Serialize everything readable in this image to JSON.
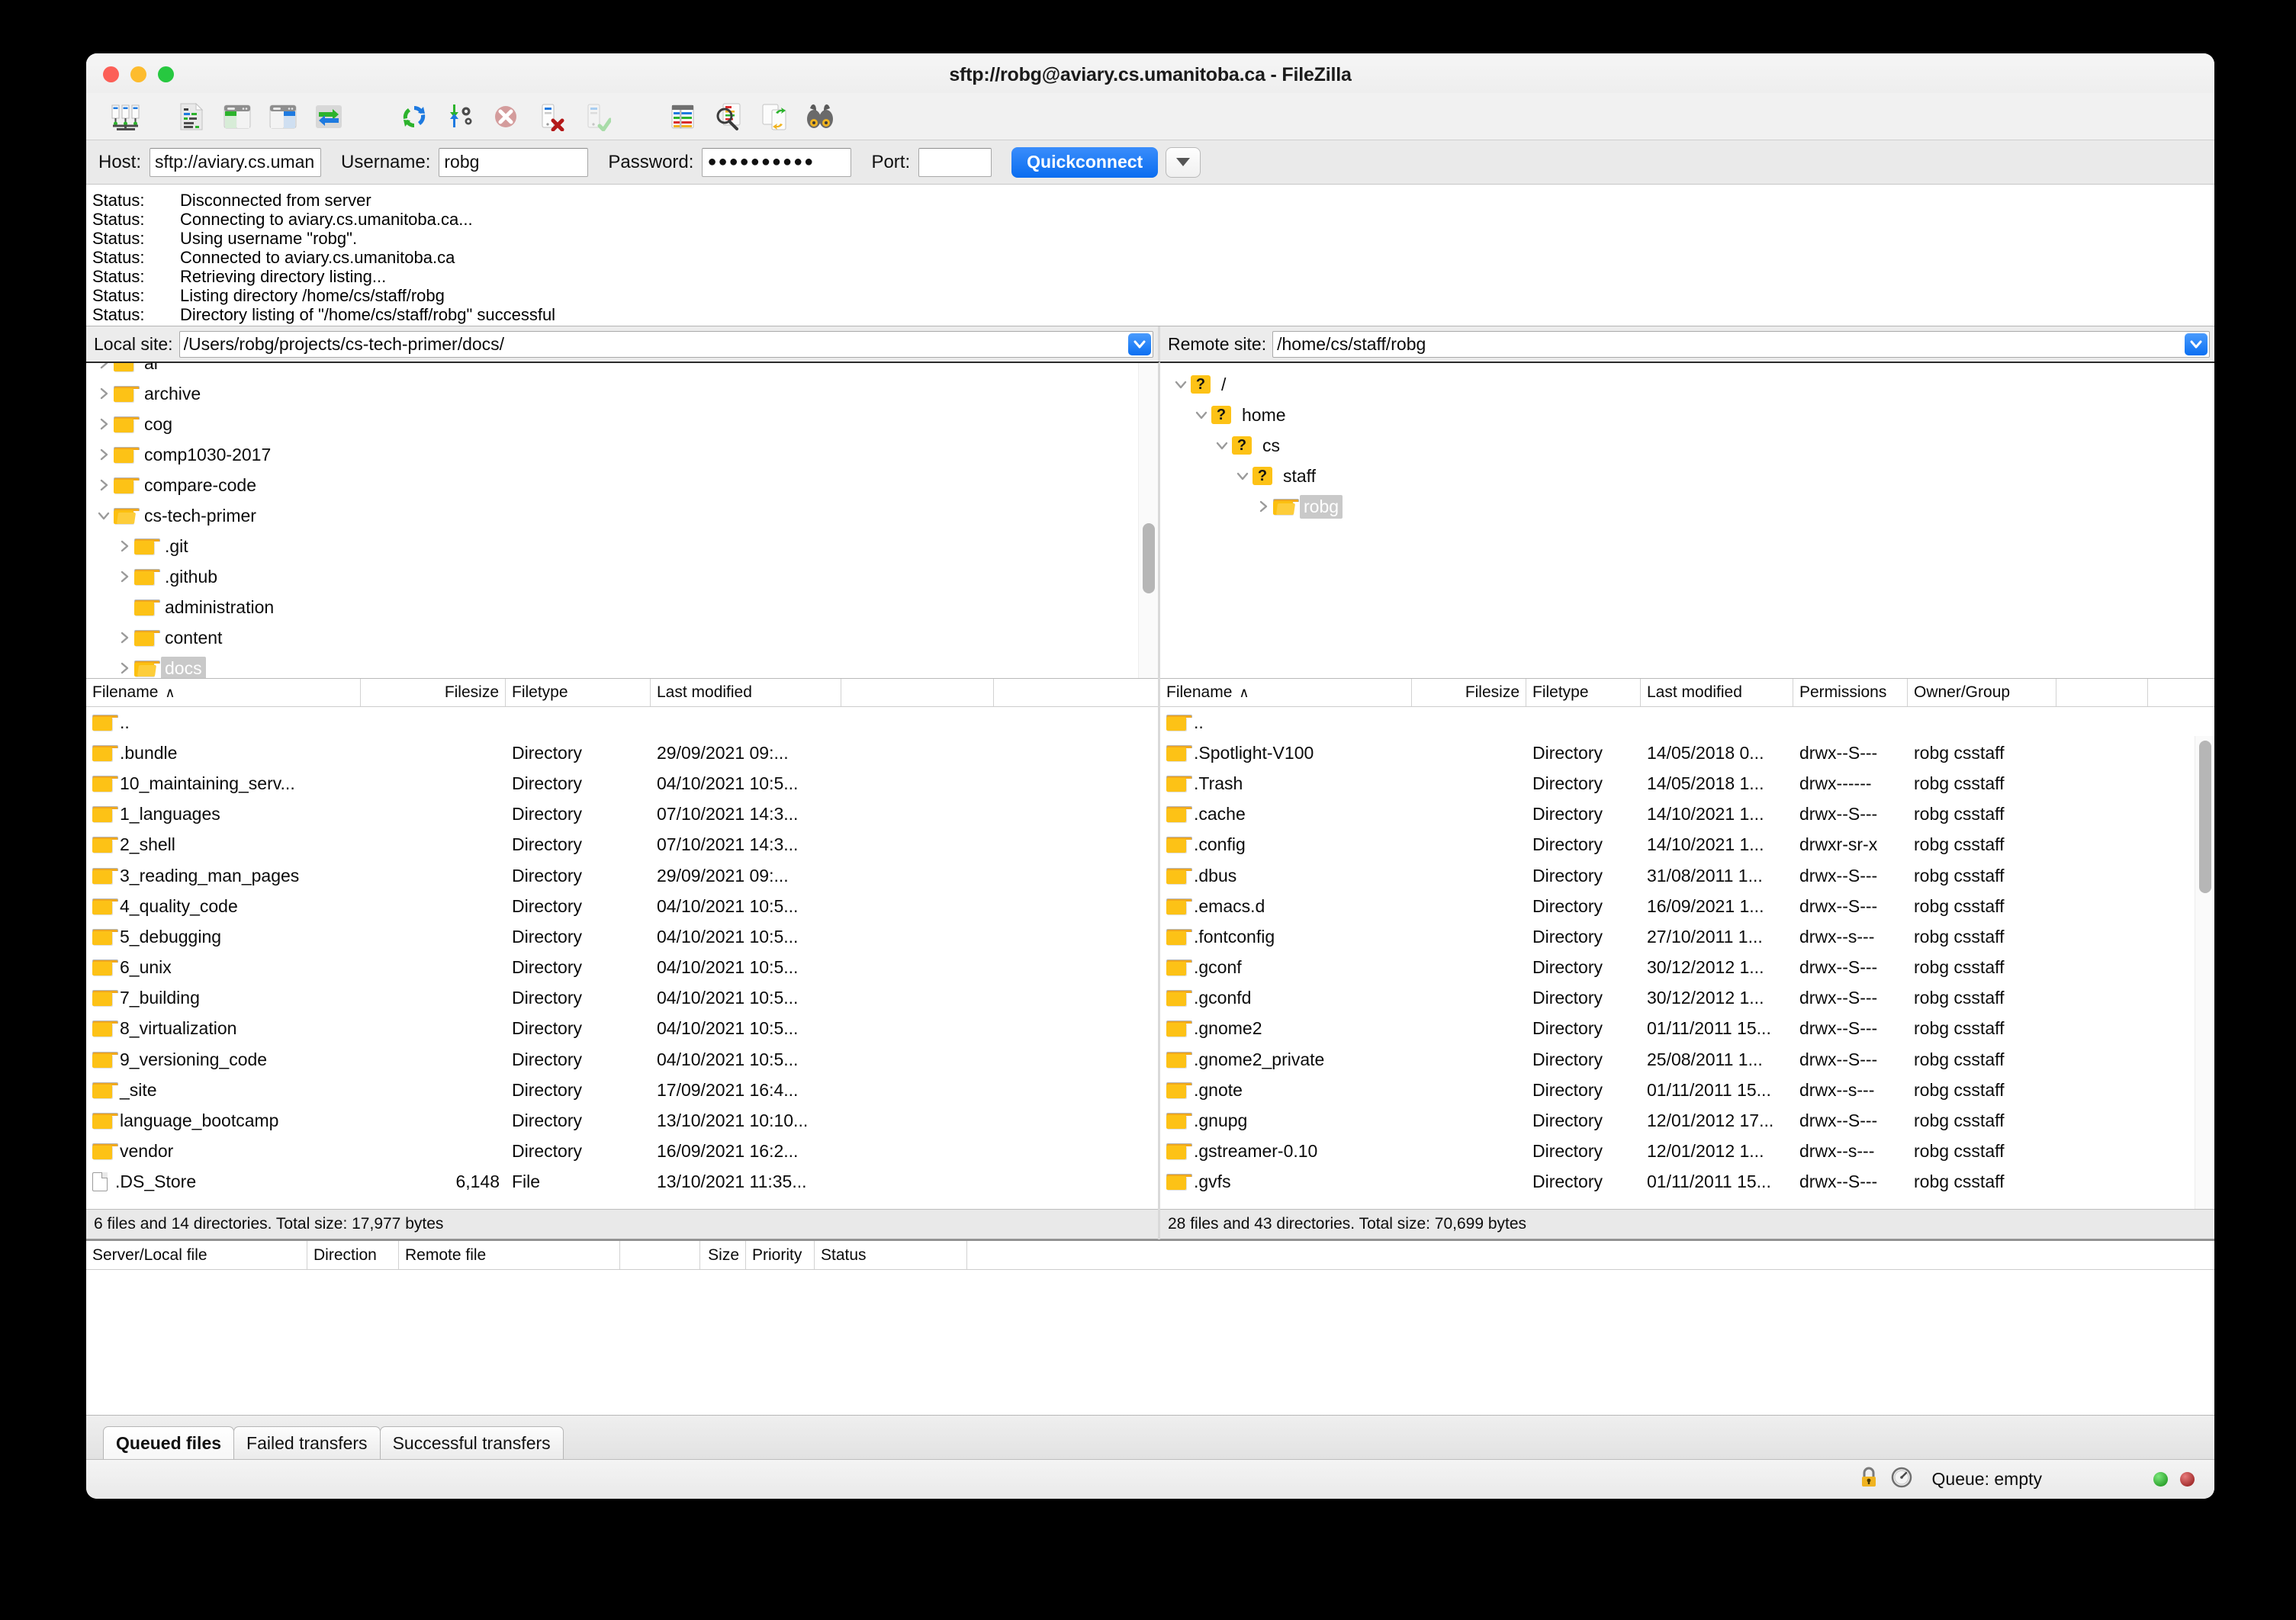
{
  "window": {
    "title": "sftp://robg@aviary.cs.umanitoba.ca - FileZilla",
    "traffic": {
      "close": "close-button",
      "minimize": "minimize-button",
      "zoom": "zoom-button"
    }
  },
  "toolbar": {
    "items": [
      {
        "name": "site-manager-icon",
        "title": "Open the Site Manager"
      },
      {
        "name": "toggle-message-log-icon",
        "title": "Toggles the display of the message log"
      },
      {
        "name": "toggle-local-tree-icon",
        "title": "Toggles the display of the local directory tree"
      },
      {
        "name": "toggle-remote-tree-icon",
        "title": "Toggles the display of the remote directory tree"
      },
      {
        "name": "toggle-transfer-queue-icon",
        "title": "Toggles the display of the transfer queue"
      },
      {
        "name": "refresh-icon",
        "title": "Refresh the file and folder lists"
      },
      {
        "name": "process-queue-icon",
        "title": "Process queue"
      },
      {
        "name": "cancel-icon",
        "title": "Cancel current operation"
      },
      {
        "name": "disconnect-icon",
        "title": "Disconnects from the currently visible server"
      },
      {
        "name": "reconnect-icon",
        "title": "Reconnects to the last used server"
      },
      {
        "name": "filter-icon",
        "title": "Open the filename filter dialog"
      },
      {
        "name": "directory-comparison-icon",
        "title": "Toggle directory comparison"
      },
      {
        "name": "synchronized-browsing-icon",
        "title": "Toggle synchronized browsing"
      },
      {
        "name": "find-files-icon",
        "title": "Search for files recursively"
      }
    ]
  },
  "quickconnect": {
    "host_label": "Host:",
    "host_value": "sftp://aviary.cs.uman",
    "username_label": "Username:",
    "username_value": "robg",
    "password_label": "Password:",
    "password_value": "●●●●●●●●●●",
    "port_label": "Port:",
    "port_value": "",
    "connect_label": "Quickconnect",
    "dropdown_name": "quickconnect-history-dropdown"
  },
  "status_log": {
    "key": "Status:",
    "lines": [
      "Disconnected from server",
      "Connecting to aviary.cs.umanitoba.ca...",
      "Using username \"robg\".",
      "Connected to aviary.cs.umanitoba.ca",
      "Retrieving directory listing...",
      "Listing directory /home/cs/staff/robg",
      "Directory listing of \"/home/cs/staff/robg\" successful"
    ]
  },
  "local": {
    "site_label": "Local site:",
    "site_path": "/Users/robg/projects/cs-tech-primer/docs/",
    "tree": [
      {
        "label": "ai",
        "depth": 1,
        "twisty": "collapsed",
        "selected": false,
        "clipped": true
      },
      {
        "label": "archive",
        "depth": 1,
        "twisty": "collapsed",
        "selected": false
      },
      {
        "label": "cog",
        "depth": 1,
        "twisty": "collapsed",
        "selected": false
      },
      {
        "label": "comp1030-2017",
        "depth": 1,
        "twisty": "collapsed",
        "selected": false
      },
      {
        "label": "compare-code",
        "depth": 1,
        "twisty": "collapsed",
        "selected": false
      },
      {
        "label": "cs-tech-primer",
        "depth": 1,
        "twisty": "expanded",
        "selected": false
      },
      {
        "label": ".git",
        "depth": 2,
        "twisty": "collapsed",
        "selected": false
      },
      {
        "label": ".github",
        "depth": 2,
        "twisty": "collapsed",
        "selected": false
      },
      {
        "label": "administration",
        "depth": 2,
        "twisty": "none",
        "selected": false
      },
      {
        "label": "content",
        "depth": 2,
        "twisty": "collapsed",
        "selected": false
      },
      {
        "label": "docs",
        "depth": 2,
        "twisty": "collapsed",
        "selected": true
      },
      {
        "label": "",
        "depth": 2,
        "twisty": "collapsed",
        "selected": false,
        "clipped": true
      }
    ],
    "columns": [
      "Filename",
      "Filesize",
      "Filetype",
      "Last modified"
    ],
    "sort_column": "Filename",
    "sort_direction": "ascending",
    "rows": [
      {
        "name": "..",
        "size": "",
        "type": "",
        "modified": "",
        "icon": "folder"
      },
      {
        "name": ".bundle",
        "size": "",
        "type": "Directory",
        "modified": "29/09/2021 09:...",
        "icon": "folder"
      },
      {
        "name": "10_maintaining_serv...",
        "size": "",
        "type": "Directory",
        "modified": "04/10/2021 10:5...",
        "icon": "folder"
      },
      {
        "name": "1_languages",
        "size": "",
        "type": "Directory",
        "modified": "07/10/2021 14:3...",
        "icon": "folder"
      },
      {
        "name": "2_shell",
        "size": "",
        "type": "Directory",
        "modified": "07/10/2021 14:3...",
        "icon": "folder"
      },
      {
        "name": "3_reading_man_pages",
        "size": "",
        "type": "Directory",
        "modified": "29/09/2021 09:...",
        "icon": "folder"
      },
      {
        "name": "4_quality_code",
        "size": "",
        "type": "Directory",
        "modified": "04/10/2021 10:5...",
        "icon": "folder"
      },
      {
        "name": "5_debugging",
        "size": "",
        "type": "Directory",
        "modified": "04/10/2021 10:5...",
        "icon": "folder"
      },
      {
        "name": "6_unix",
        "size": "",
        "type": "Directory",
        "modified": "04/10/2021 10:5...",
        "icon": "folder"
      },
      {
        "name": "7_building",
        "size": "",
        "type": "Directory",
        "modified": "04/10/2021 10:5...",
        "icon": "folder"
      },
      {
        "name": "8_virtualization",
        "size": "",
        "type": "Directory",
        "modified": "04/10/2021 10:5...",
        "icon": "folder"
      },
      {
        "name": "9_versioning_code",
        "size": "",
        "type": "Directory",
        "modified": "04/10/2021 10:5...",
        "icon": "folder"
      },
      {
        "name": "_site",
        "size": "",
        "type": "Directory",
        "modified": "17/09/2021 16:4...",
        "icon": "folder"
      },
      {
        "name": "language_bootcamp",
        "size": "",
        "type": "Directory",
        "modified": "13/10/2021 10:10...",
        "icon": "folder"
      },
      {
        "name": "vendor",
        "size": "",
        "type": "Directory",
        "modified": "16/09/2021 16:2...",
        "icon": "folder"
      },
      {
        "name": ".DS_Store",
        "size": "6,148",
        "type": "File",
        "modified": "13/10/2021 11:35...",
        "icon": "file"
      }
    ],
    "status": "6 files and 14 directories. Total size: 17,977 bytes"
  },
  "remote": {
    "site_label": "Remote site:",
    "site_path": "/home/cs/staff/robg",
    "tree": [
      {
        "label": "/",
        "depth": 0,
        "twisty": "expanded",
        "icon": "unknown",
        "selected": false
      },
      {
        "label": "home",
        "depth": 1,
        "twisty": "expanded",
        "icon": "unknown",
        "selected": false
      },
      {
        "label": "cs",
        "depth": 2,
        "twisty": "expanded",
        "icon": "unknown",
        "selected": false
      },
      {
        "label": "staff",
        "depth": 3,
        "twisty": "expanded",
        "icon": "unknown",
        "selected": false
      },
      {
        "label": "robg",
        "depth": 4,
        "twisty": "collapsed",
        "icon": "folder",
        "selected": true
      }
    ],
    "columns": [
      "Filename",
      "Filesize",
      "Filetype",
      "Last modified",
      "Permissions",
      "Owner/Group"
    ],
    "sort_column": "Filename",
    "sort_direction": "ascending",
    "rows": [
      {
        "name": "..",
        "size": "",
        "type": "",
        "modified": "",
        "perms": "",
        "owner": "",
        "icon": "folder"
      },
      {
        "name": ".Spotlight-V100",
        "size": "",
        "type": "Directory",
        "modified": "14/05/2018 0...",
        "perms": "drwx--S---",
        "owner": "robg csstaff",
        "icon": "folder"
      },
      {
        "name": ".Trash",
        "size": "",
        "type": "Directory",
        "modified": "14/05/2018 1...",
        "perms": "drwx------",
        "owner": "robg csstaff",
        "icon": "folder"
      },
      {
        "name": ".cache",
        "size": "",
        "type": "Directory",
        "modified": "14/10/2021 1...",
        "perms": "drwx--S---",
        "owner": "robg csstaff",
        "icon": "folder"
      },
      {
        "name": ".config",
        "size": "",
        "type": "Directory",
        "modified": "14/10/2021 1...",
        "perms": "drwxr-sr-x",
        "owner": "robg csstaff",
        "icon": "folder"
      },
      {
        "name": ".dbus",
        "size": "",
        "type": "Directory",
        "modified": "31/08/2011 1...",
        "perms": "drwx--S---",
        "owner": "robg csstaff",
        "icon": "folder"
      },
      {
        "name": ".emacs.d",
        "size": "",
        "type": "Directory",
        "modified": "16/09/2021 1...",
        "perms": "drwx--S---",
        "owner": "robg csstaff",
        "icon": "folder"
      },
      {
        "name": ".fontconfig",
        "size": "",
        "type": "Directory",
        "modified": "27/10/2011 1...",
        "perms": "drwx--s---",
        "owner": "robg csstaff",
        "icon": "folder"
      },
      {
        "name": ".gconf",
        "size": "",
        "type": "Directory",
        "modified": "30/12/2012 1...",
        "perms": "drwx--S---",
        "owner": "robg csstaff",
        "icon": "folder"
      },
      {
        "name": ".gconfd",
        "size": "",
        "type": "Directory",
        "modified": "30/12/2012 1...",
        "perms": "drwx--S---",
        "owner": "robg csstaff",
        "icon": "folder"
      },
      {
        "name": ".gnome2",
        "size": "",
        "type": "Directory",
        "modified": "01/11/2011 15...",
        "perms": "drwx--S---",
        "owner": "robg csstaff",
        "icon": "folder"
      },
      {
        "name": ".gnome2_private",
        "size": "",
        "type": "Directory",
        "modified": "25/08/2011 1...",
        "perms": "drwx--S---",
        "owner": "robg csstaff",
        "icon": "folder"
      },
      {
        "name": ".gnote",
        "size": "",
        "type": "Directory",
        "modified": "01/11/2011 15...",
        "perms": "drwx--s---",
        "owner": "robg csstaff",
        "icon": "folder"
      },
      {
        "name": ".gnupg",
        "size": "",
        "type": "Directory",
        "modified": "12/01/2012 17...",
        "perms": "drwx--S---",
        "owner": "robg csstaff",
        "icon": "folder"
      },
      {
        "name": ".gstreamer-0.10",
        "size": "",
        "type": "Directory",
        "modified": "12/01/2012 1...",
        "perms": "drwx--s---",
        "owner": "robg csstaff",
        "icon": "folder"
      },
      {
        "name": ".gvfs",
        "size": "",
        "type": "Directory",
        "modified": "01/11/2011 15...",
        "perms": "drwx--S---",
        "owner": "robg csstaff",
        "icon": "folder"
      }
    ],
    "status": "28 files and 43 directories. Total size: 70,699 bytes"
  },
  "queue": {
    "columns": [
      "Server/Local file",
      "Direction",
      "Remote file",
      "",
      "Size",
      "Priority",
      "Status"
    ],
    "rows": []
  },
  "tabs": [
    {
      "label": "Queued files",
      "active": true
    },
    {
      "label": "Failed transfers",
      "active": false
    },
    {
      "label": "Successful transfers",
      "active": false
    }
  ],
  "bottom_status": {
    "lock_icon": "lock-icon",
    "speed_icon": "speed-gauge-icon",
    "queue_text": "Queue: empty",
    "led_green": "#128a12",
    "led_red": "#8a1212"
  },
  "colors": {
    "accent_blue": "#0a6df0",
    "folder_yellow": "#fdc216",
    "window_bg": "#f1f1f1"
  }
}
